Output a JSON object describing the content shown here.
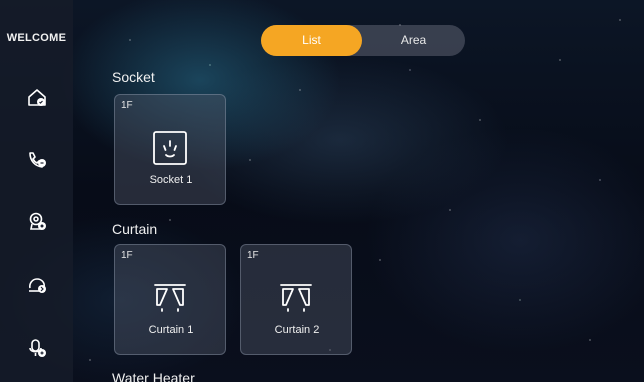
{
  "sidebar": {
    "welcome": "WELCOME",
    "items": [
      {
        "icon": "home-shield-icon"
      },
      {
        "icon": "phone-call-icon"
      },
      {
        "icon": "camera-settings-icon"
      },
      {
        "icon": "cloud-person-icon"
      },
      {
        "icon": "microphone-icon"
      }
    ]
  },
  "tabs": {
    "list": "List",
    "area": "Area",
    "active": "List",
    "active_color": "#f5a623"
  },
  "sections": {
    "socket": {
      "title": "Socket",
      "devices": [
        {
          "floor": "1F",
          "name": "Socket 1",
          "icon": "socket-icon"
        }
      ]
    },
    "curtain": {
      "title": "Curtain",
      "devices": [
        {
          "floor": "1F",
          "name": "Curtain 1",
          "icon": "curtain-icon"
        },
        {
          "floor": "1F",
          "name": "Curtain 2",
          "icon": "curtain-icon"
        }
      ]
    },
    "water_heater": {
      "title": "Water Heater"
    }
  }
}
